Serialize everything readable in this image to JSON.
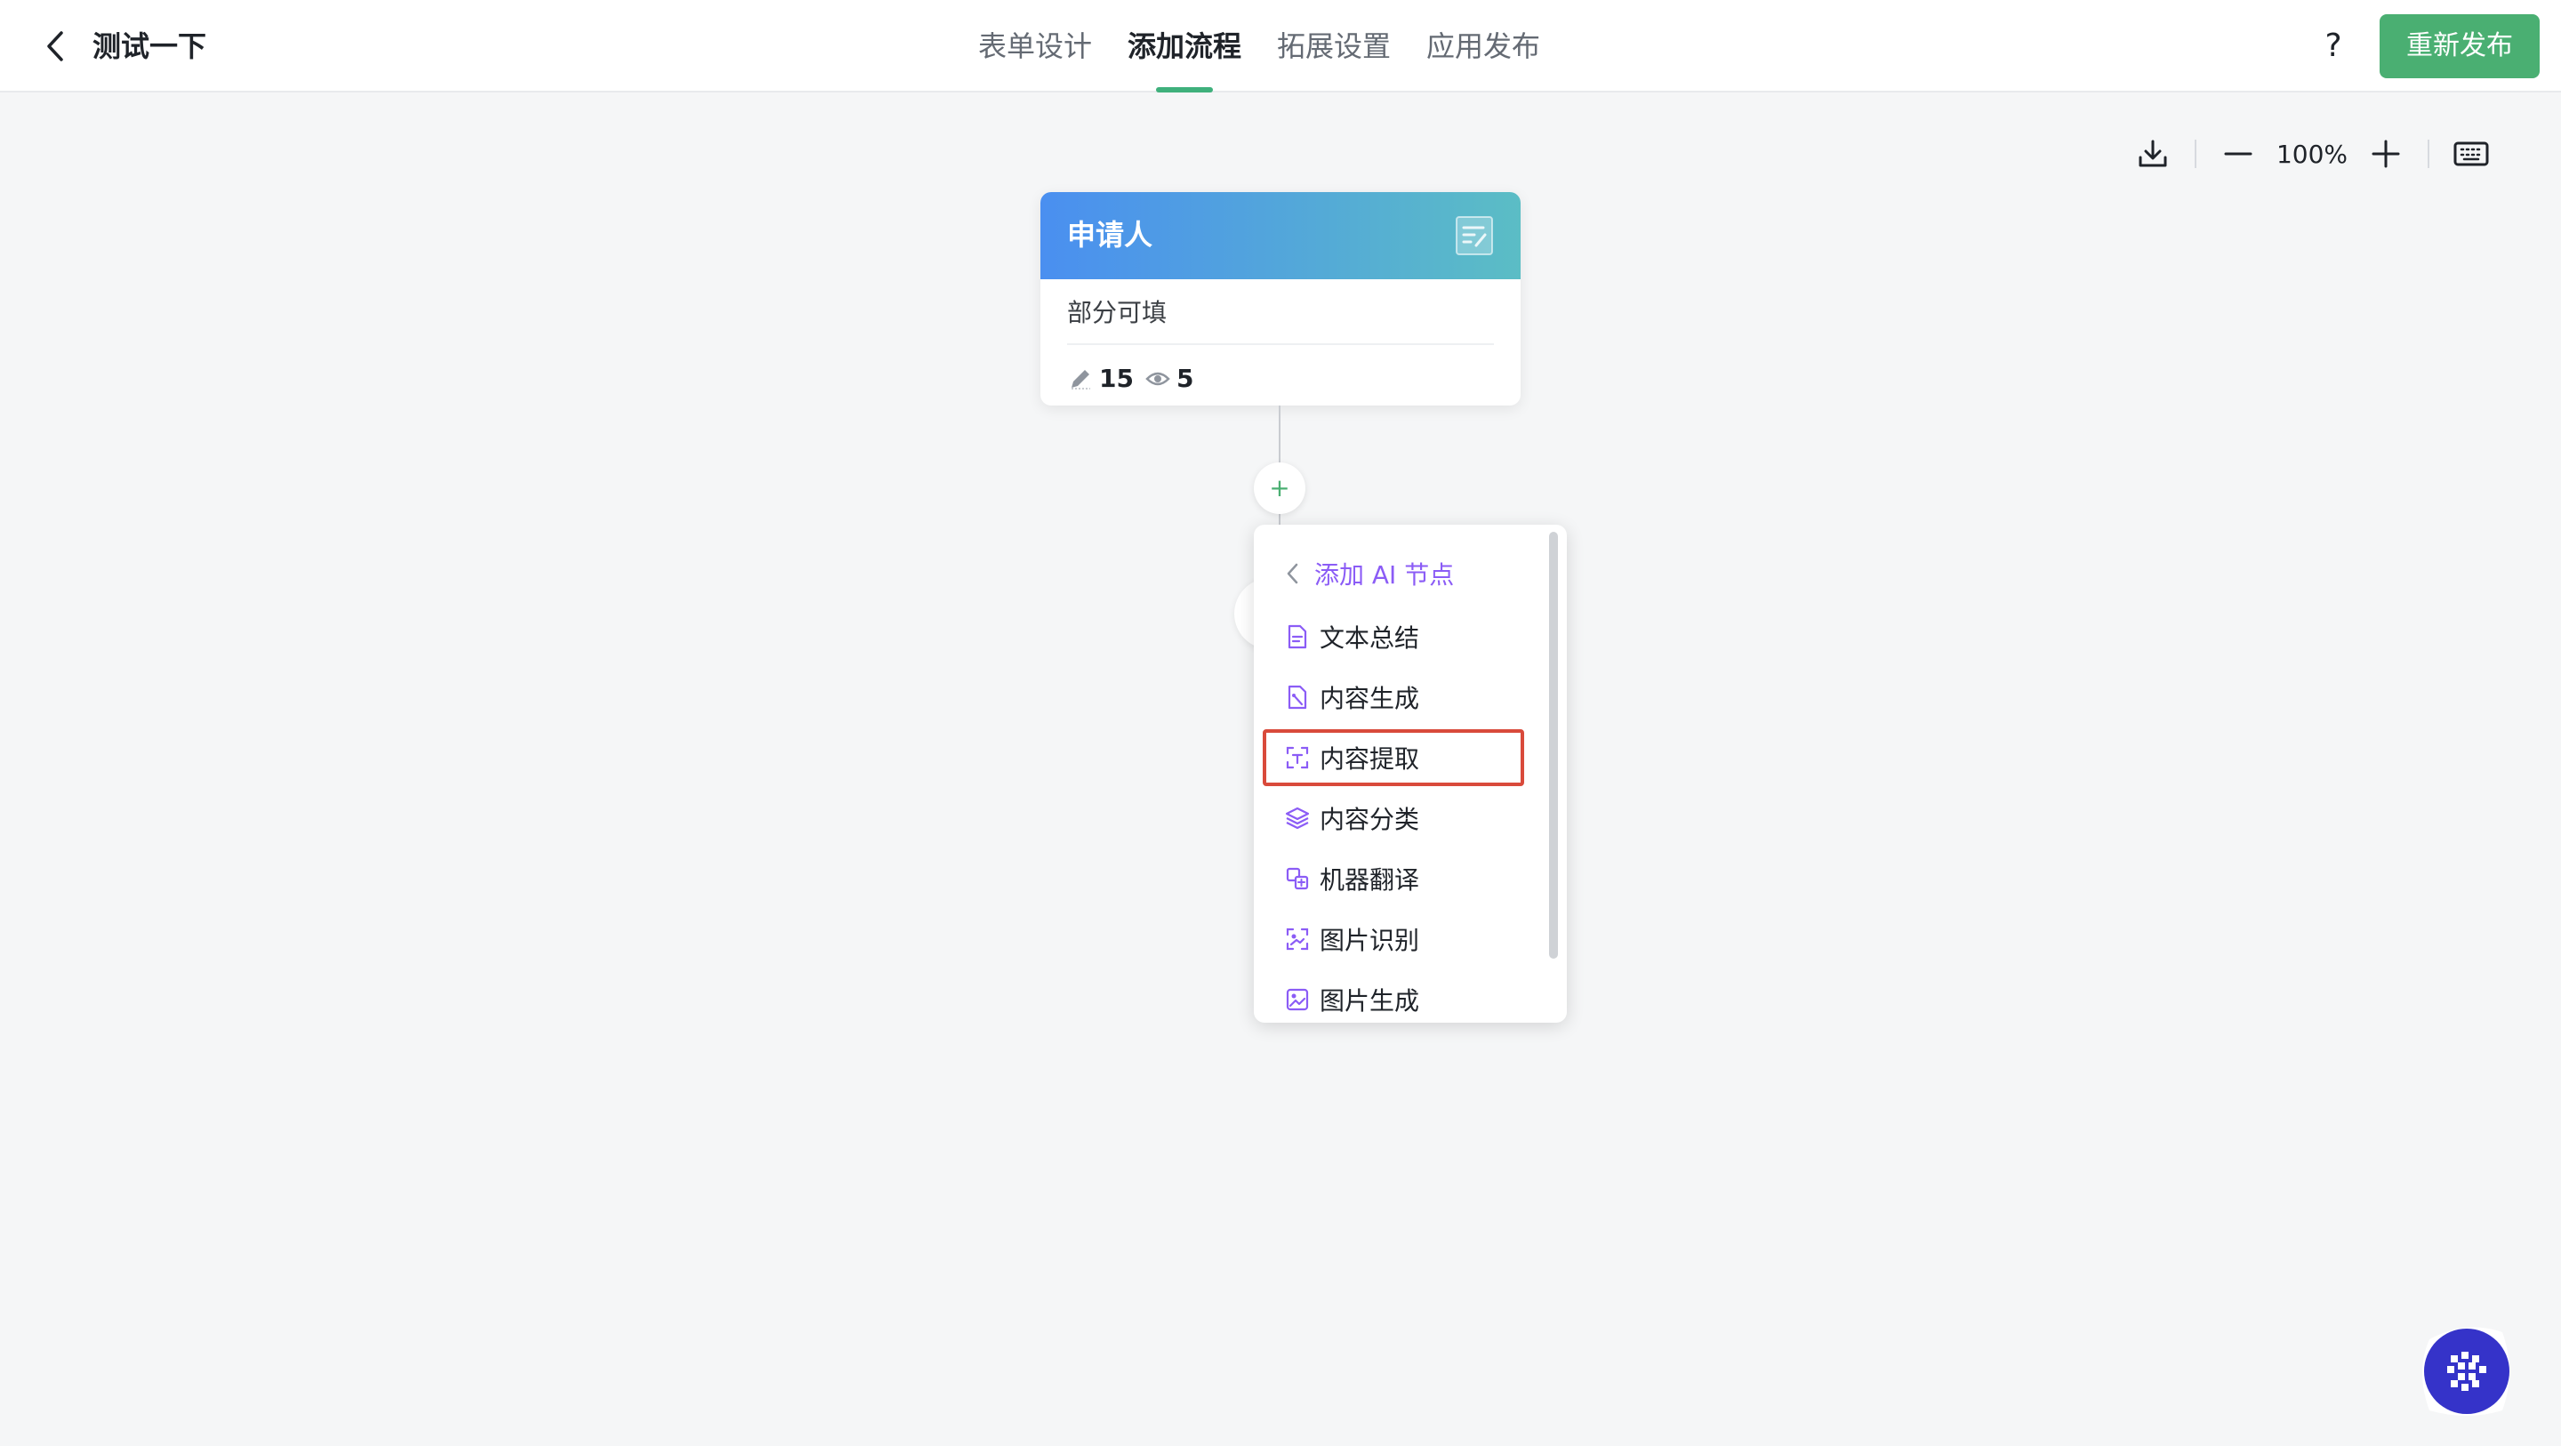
{
  "header": {
    "title": "测试一下",
    "tabs": [
      {
        "label": "表单设计",
        "active": false
      },
      {
        "label": "添加流程",
        "active": true
      },
      {
        "label": "拓展设置",
        "active": false
      },
      {
        "label": "应用发布",
        "active": false
      }
    ],
    "help": "?",
    "publish_label": "重新发布"
  },
  "toolbar": {
    "zoom": "100%",
    "icons": [
      "download-icon",
      "zoom-out-icon",
      "zoom-in-icon",
      "keyboard-icon"
    ]
  },
  "flow": {
    "node": {
      "title": "申请人",
      "subtitle": "部分可填",
      "editable_count": "15",
      "visible_count": "5"
    },
    "add_symbol": "+"
  },
  "ai_menu": {
    "header": "添加 AI 节点",
    "items": [
      {
        "label": "文本总结",
        "icon": "text-summary-icon"
      },
      {
        "label": "内容生成",
        "icon": "content-generate-icon"
      },
      {
        "label": "内容提取",
        "icon": "content-extract-icon",
        "highlighted": true
      },
      {
        "label": "内容分类",
        "icon": "layers-icon"
      },
      {
        "label": "机器翻译",
        "icon": "translate-icon"
      },
      {
        "label": "图片识别",
        "icon": "image-recognize-icon"
      },
      {
        "label": "图片生成",
        "icon": "image-generate-icon"
      }
    ]
  },
  "colors": {
    "accent_green": "#4aaf72",
    "menu_purple": "#8b5cf6",
    "highlight_red": "#d94a3b",
    "node_gradient_start": "#4a8ff0",
    "node_gradient_end": "#5bbdc5"
  }
}
